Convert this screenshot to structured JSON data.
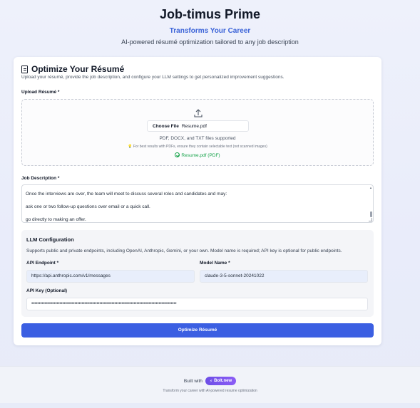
{
  "header": {
    "title": "Job-timus Prime",
    "tagline": "Transforms Your Career",
    "subtitle": "AI-powered résumé optimization tailored to any job description"
  },
  "card": {
    "title": "Optimize Your Résumé",
    "description": "Upload your résumé, provide the job description, and configure your LLM settings to get personalized improvement suggestions."
  },
  "upload": {
    "label": "Upload Résumé *",
    "choose_label": "Choose File",
    "file_name": "Resume.pdf",
    "formats": "PDF, DOCX, and TXT files supported",
    "tip": "For best results with PDFs, ensure they contain selectable text (not scanned images)",
    "selected": "Resume.pdf (PDF)"
  },
  "job_description": {
    "label": "Job Description *",
    "lines": [
      "Once the interviews are over, the team will meet to discuss several roles and candidates and may:",
      "ask one or two follow-up questions over email or a quick call.",
      "go directly to making an offer."
    ]
  },
  "llm": {
    "title": "LLM Configuration",
    "description": "Supports public and private endpoints, including OpenAI, Anthropic, Gemini, or your own. Model name is required; API key is optional for public endpoints.",
    "endpoint_label": "API Endpoint *",
    "endpoint_value": "https://api.anthropic.com/v1/messages",
    "model_label": "Model Name *",
    "model_value": "claude-3-5-sonnet-20241022",
    "key_label": "API Key (Optional)",
    "key_value": "••••••••••••••••••••••••••••••••••••••••••••••••••••••••••••••••••••••••••••••••••••••••••••••••••"
  },
  "submit_label": "Optimize Résumé",
  "footer": {
    "built_with": "Built with",
    "badge": "Bolt.new",
    "note": "Transform your career with AI-powered resume optimization"
  },
  "colors": {
    "accent": "#3b5fe2",
    "tagline": "#3b63d8",
    "success": "#16a34a",
    "badge": "#7c4dff"
  }
}
